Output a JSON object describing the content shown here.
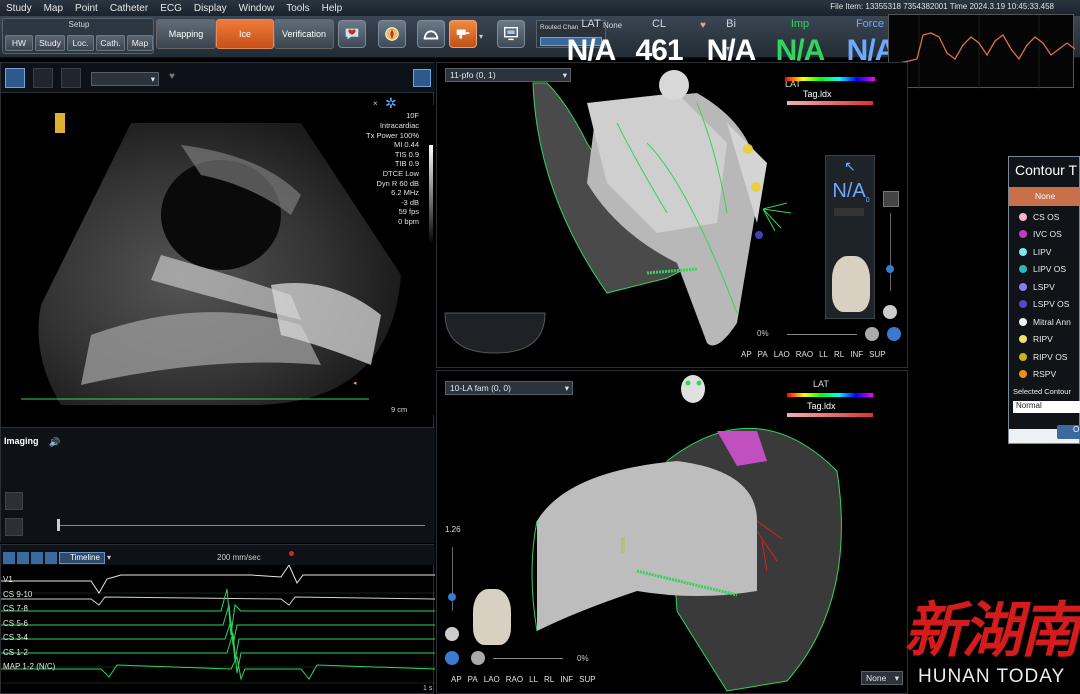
{
  "menu": [
    "Study",
    "Map",
    "Point",
    "Catheter",
    "ECG",
    "Display",
    "Window",
    "Tools",
    "Help"
  ],
  "file_info": "File Item: 13355318 7354382001  Time 2024.3.19 10:45:33.458",
  "toolbar": {
    "setup_title": "Setup",
    "setup_buttons": [
      "HW",
      "Study",
      "Loc.",
      "Cath.",
      "Map"
    ],
    "mode_buttons": [
      "Mapping",
      "Ice",
      "Verification"
    ],
    "routed_label": "Routed Chan"
  },
  "metrics": {
    "labels": [
      "LAT",
      "CL",
      "Bi",
      "Imp",
      "Force"
    ],
    "values": [
      "N/A",
      "461",
      "N/A",
      "N/A",
      "N/A"
    ],
    "none_label": "None",
    "colors": [
      "#ffffff",
      "#ffffff",
      "#ffffff",
      "#2fd65a",
      "#6fa8ff"
    ]
  },
  "ice": {
    "freq": "10F",
    "params": [
      "Intracardiac",
      "Tx Power 100%",
      "MI 0.44",
      "TIS 0.9",
      "TIB 0.9",
      "DTCE Low",
      "Dyn R 60 dB",
      "6.2 MHz",
      "-3 dB",
      "59 fps",
      "0 bpm"
    ],
    "depth": "9 cm",
    "imaging_label": "Imaging"
  },
  "ecg": {
    "speed": "200 mm/sec",
    "timeline_label": "Timeline",
    "leads": [
      "V1",
      "CS 9-10",
      "CS 7-8",
      "CS 5-6",
      "CS 3-4",
      "CS 1-2",
      "MAP 1-2 (N/C)"
    ],
    "end_label": "1 s"
  },
  "view1": {
    "title": "11-pfo (0, 1)",
    "na_label": "N/A",
    "na_sub": "0",
    "percent": "0%",
    "views": [
      "AP",
      "PA",
      "LAO",
      "RAO",
      "LL",
      "RL",
      "INF",
      "SUP"
    ],
    "lat_label": "LAT",
    "tag_label": "Tag.ldx"
  },
  "view2": {
    "title": "10-LA fam (0, 0)",
    "scale_label": "1.26",
    "percent": "0%",
    "views": [
      "AP",
      "PA",
      "LAO",
      "RAO",
      "LL",
      "RL",
      "INF",
      "SUP"
    ],
    "lat_label": "LAT",
    "tag_label": "Tag.ldx",
    "none_select": "None"
  },
  "contour": {
    "title": "Contour T",
    "selected": "None",
    "items": [
      {
        "name": "CS OS",
        "color": "#f4b6c6"
      },
      {
        "name": "IVC OS",
        "color": "#c03cc0"
      },
      {
        "name": "LIPV",
        "color": "#7ee8e8"
      },
      {
        "name": "LIPV OS",
        "color": "#2ab8b8"
      },
      {
        "name": "LSPV",
        "color": "#8a7cf0"
      },
      {
        "name": "LSPV OS",
        "color": "#5b46c8"
      },
      {
        "name": "Mitral Ann",
        "color": "#f2f2f2"
      },
      {
        "name": "RIPV",
        "color": "#f2e070"
      },
      {
        "name": "RIPV OS",
        "color": "#c8b41c"
      },
      {
        "name": "RSPV",
        "color": "#f08c1c"
      }
    ],
    "selected_contour_label": "Selected Contour",
    "select_value": "Normal",
    "ok_label": "O"
  },
  "watermark": {
    "cn": "新湖南",
    "en": "HUNAN TODAY"
  }
}
